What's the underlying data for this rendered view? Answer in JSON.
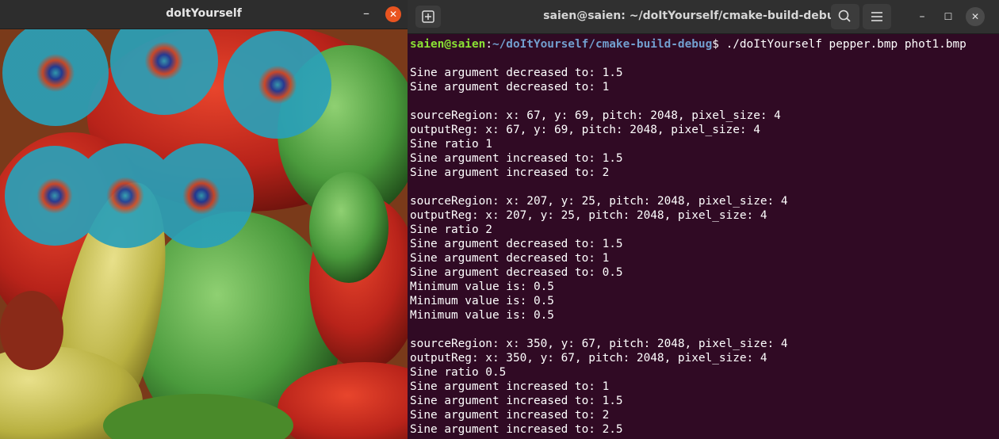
{
  "image_window": {
    "title": "doItYourself",
    "minimize_glyph": "–",
    "close_glyph": "✕",
    "colors": {
      "close_button": "#e95420",
      "titlebar": "#2d2d2d"
    }
  },
  "terminal_window": {
    "title": "saien@saien: ~/doItYourself/cmake-build-debug",
    "minimize_glyph": "–",
    "maximize_glyph": "☐",
    "close_glyph": "✕",
    "icons": [
      "new-tab-icon",
      "search-icon",
      "hamburger-menu-icon"
    ],
    "colors": {
      "background": "#300a24",
      "prompt_user": "#8ae234",
      "prompt_path": "#729fcf"
    },
    "prompt": {
      "user_host": "saien@saien",
      "separator": ":",
      "path": "~/doItYourself/cmake-build-debug",
      "symbol": "$",
      "command": " ./doItYourself pepper.bmp phot1.bmp"
    },
    "lines": [
      "",
      "Sine argument decreased to: 1.5",
      "Sine argument decreased to: 1",
      "",
      "sourceRegion: x: 67, y: 69, pitch: 2048, pixel_size: 4",
      "outputReg: x: 67, y: 69, pitch: 2048, pixel_size: 4",
      "Sine ratio 1",
      "Sine argument increased to: 1.5",
      "Sine argument increased to: 2",
      "",
      "sourceRegion: x: 207, y: 25, pitch: 2048, pixel_size: 4",
      "outputReg: x: 207, y: 25, pitch: 2048, pixel_size: 4",
      "Sine ratio 2",
      "Sine argument decreased to: 1.5",
      "Sine argument decreased to: 1",
      "Sine argument decreased to: 0.5",
      "Minimum value is: 0.5",
      "Minimum value is: 0.5",
      "Minimum value is: 0.5",
      "",
      "sourceRegion: x: 350, y: 67, pitch: 2048, pixel_size: 4",
      "outputReg: x: 350, y: 67, pitch: 2048, pixel_size: 4",
      "Sine ratio 0.5",
      "Sine argument increased to: 1",
      "Sine argument increased to: 1.5",
      "Sine argument increased to: 2",
      "Sine argument increased to: 2.5"
    ]
  }
}
